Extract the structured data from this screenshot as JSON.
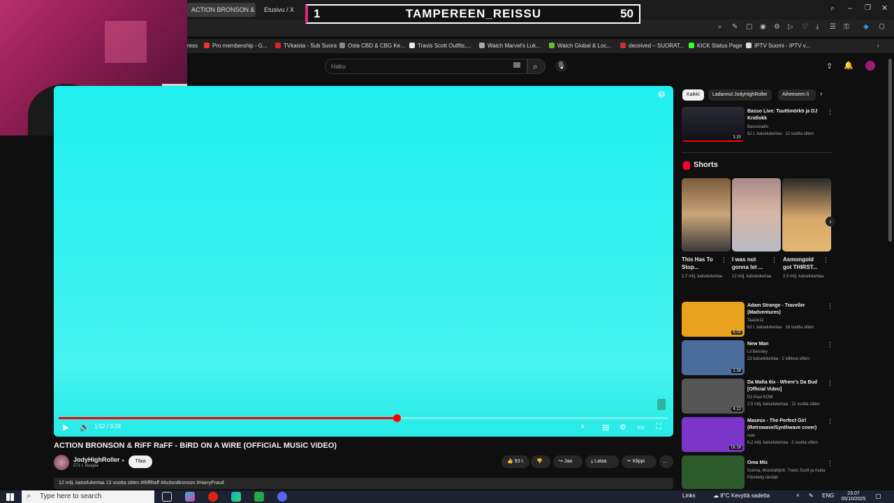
{
  "browser": {
    "tabs": [
      "ACTION BRONSON & RiFF",
      "Etusivu / X"
    ],
    "new_tab": "+",
    "window_controls": [
      "search-icon",
      "minimize-icon",
      "restore-icon",
      "close-icon"
    ]
  },
  "bookmarks": [
    {
      "label": "ress",
      "icon": ""
    },
    {
      "label": "Pro membership - G...",
      "icon": "#e33"
    },
    {
      "label": "TVkaista - Sub Suora",
      "icon": "#d22"
    },
    {
      "label": "Osta CBD & CBG Ke...",
      "icon": "#888"
    },
    {
      "label": "Travis Scott Outfits,...",
      "icon": "#eee"
    },
    {
      "label": "Watch Marvel's Luk...",
      "icon": "#aaa"
    },
    {
      "label": "Watch Global & Loc...",
      "icon": "#6b3"
    },
    {
      "label": "deceived – SUORAT...",
      "icon": "#c33"
    },
    {
      "label": "KICK Status Page",
      "icon": "#3f3"
    },
    {
      "label": "IPTV Suomi - IPTV v...",
      "icon": "#ddd"
    }
  ],
  "overlay": {
    "left": "1",
    "title": "TAMPEREEN_REISSU",
    "right": "50"
  },
  "search": {
    "placeholder": "Haku"
  },
  "player": {
    "time": "1:52 / 3:28",
    "progress": 0.555
  },
  "video": {
    "title": "ACTION BRONSON & RiFF RaFF - BiRD ON A WiRE (OFFiCiAL MUSiC ViDEO)",
    "channel": "JodyHighRoller",
    "subs": "571 t. tilaajaa",
    "subscribe": "Tilaa",
    "likes": "93 t.",
    "share": "Jaa",
    "download": "Lataa",
    "clip": "Klippi",
    "more": "...",
    "description": "12 milj. katselukertaa  13 vuotta sitten  #RiffRaff #ActionBronson #HarryFraud"
  },
  "chips": [
    "Kaikki",
    "Ladannut JodyHighRoller",
    "Aiheeseen li"
  ],
  "related_top": {
    "title": "Basso Live: Tuuttimörkö ja DJ Kridlokk",
    "channel": "Bassoradio",
    "meta": "62 t. katselukertaa · 12 vuotta sitten",
    "duration": "3.33"
  },
  "shorts": {
    "label": "Shorts",
    "items": [
      {
        "title": "This Has To Stop...",
        "meta": "2,7 milj. katselukertaa"
      },
      {
        "title": "I was not gonna let ...",
        "meta": "12 milj. katselukertaa"
      },
      {
        "title": "Asmongold got THIRST...",
        "meta": "2,3 milj. katselukertaa"
      }
    ]
  },
  "related": [
    {
      "title": "Adam Strange - Traveller (Madventures)",
      "channel": "Taaslo11",
      "meta": "62 t. katselukertaa · 16 vuotta sitten",
      "duration": "6.00",
      "color": "#e8a21e"
    },
    {
      "title": "New Man",
      "channel": "Lil Bensley",
      "meta": "23 katselukertaa · 2 viikkoa sitten",
      "duration": "2.38",
      "color": "#4a6c9c"
    },
    {
      "title": "Da Mafia 6ix - Where's Da Bud [Official Video]",
      "channel": "DJ Paul KOM",
      "meta": "2,5 milj. katselukertaa · 11 vuotta sitten",
      "duration": "4.12",
      "color": "#555555"
    },
    {
      "title": "Maseux - The Perfect Girl (Retrowave/Synthwave cover)",
      "channel": "Ivan",
      "meta": "6,2 milj. katselukertaa · 2 vuotta sitten",
      "duration": "16.16",
      "color": "#7a36c8"
    },
    {
      "title": "Oma Mix",
      "channel": "Gunna, Moustattijrdt, Travis Scott ja muita",
      "meta": "Päivitetty tänään",
      "duration": "",
      "color": "#2d5a2a"
    }
  ],
  "taskbar": {
    "search_placeholder": "Type here to search",
    "links": "Links",
    "weather": "8°C  Kevyttä sadetta",
    "lang": "ENG",
    "time": "23.07",
    "date": "05/10/2025"
  }
}
